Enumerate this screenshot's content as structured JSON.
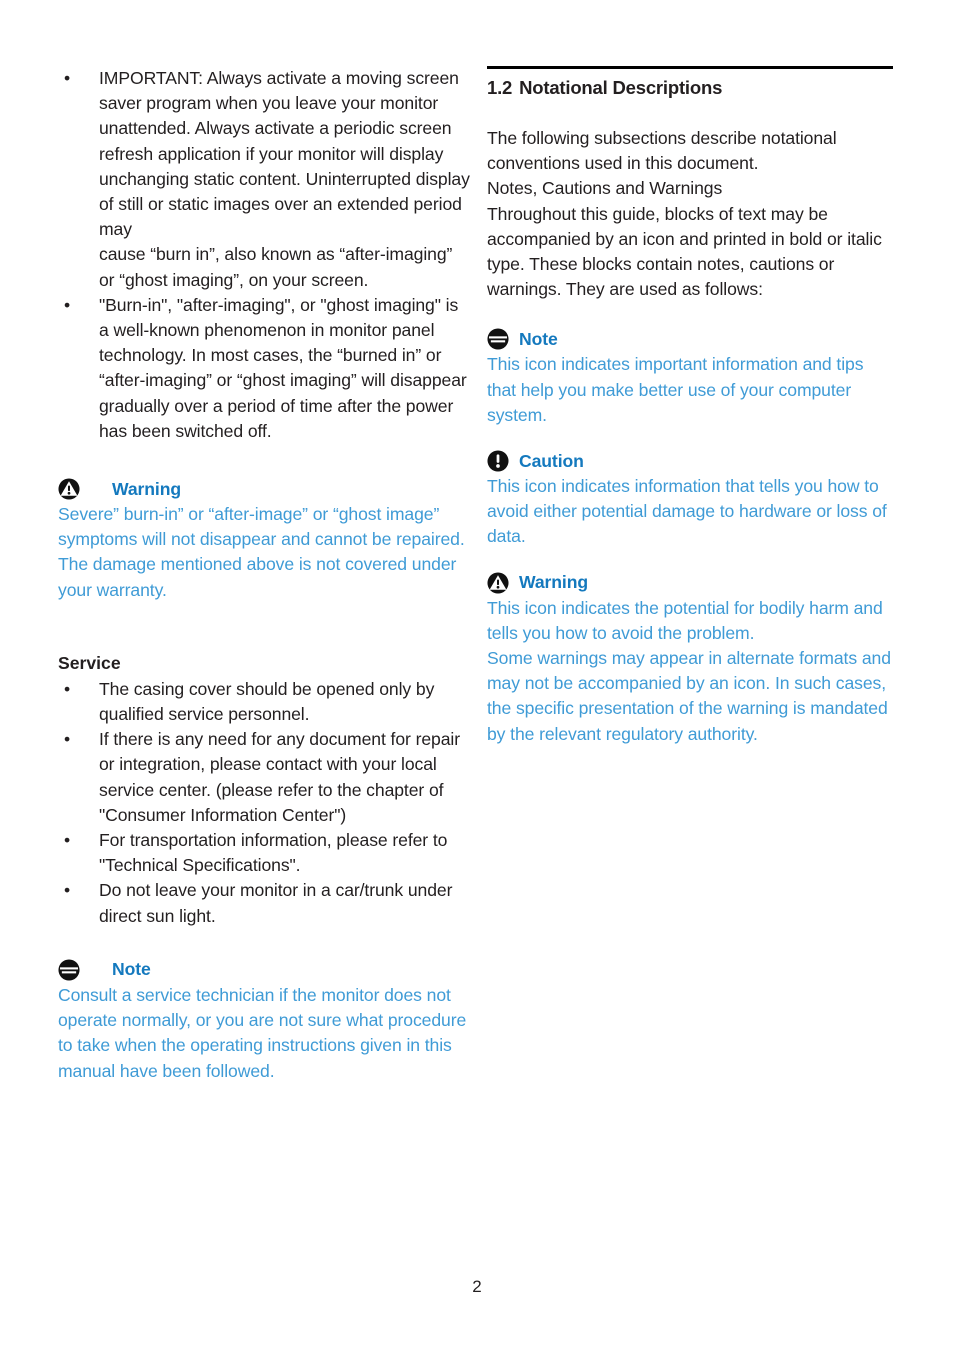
{
  "colors": {
    "heading_blue": "#1479be",
    "body_blue": "#3f9bd6",
    "text_black": "#231f20",
    "rule_black": "#000000"
  },
  "left_column": {
    "bullets": [
      "IMPORTANT: Always activate a moving screen saver program when you leave your monitor unattended. Always activate a periodic screen refresh application if your monitor will display unchanging static content. Uninterrupted display of still or static images over an extended period may\ncause “burn in”, also known as “after-imaging” or “ghost imaging”,  on your screen.",
      "\"Burn-in\", \"after-imaging\", or \"ghost imaging\" is a well-known phenomenon in monitor panel technology. In most cases, the “burned in” or “after-imaging” or “ghost imaging” will disappear gradually over a period of time after the power has been switched off."
    ],
    "warning_callout": {
      "icon": "warning-triangle-icon",
      "label": "Warning",
      "body": "Severe” burn-in” or “after-image” or “ghost image” symptoms will not disappear and cannot be repaired. The damage mentioned above is not covered under your warranty."
    },
    "service": {
      "heading": "Service",
      "bullets": [
        "The casing cover should be opened only by qualified service personnel.",
        "If there is any need for any document for repair or integration, please contact with your local service center. (please refer to the chapter of \"Consumer Information Center\")",
        "For transportation information, please refer to \"Technical Specifications\".",
        "Do not leave your monitor in a car/trunk under direct sun light."
      ]
    },
    "note_callout": {
      "icon": "note-lines-icon",
      "label": "Note",
      "body": "Consult a service technician if the monitor does not operate normally, or you are not sure what procedure to take when the operating instructions given in this manual have been followed."
    }
  },
  "right_column": {
    "section": {
      "number": "1.2",
      "title": "Notational Descriptions"
    },
    "intro": "The following subsections describe notational conventions used in this document.\nNotes, Cautions and Warnings\nThroughout this guide, blocks of text may be accompanied by an icon and printed in bold or italic type. These blocks contain notes, cautions or warnings. They are used as follows:",
    "callouts": [
      {
        "icon": "note-lines-icon",
        "label": "Note",
        "body": "This icon indicates important information and tips that help you make better use of your computer system."
      },
      {
        "icon": "caution-exclamation-icon",
        "label": "Caution",
        "body": "This icon indicates information that tells you how to avoid either potential damage to hardware or loss of data."
      },
      {
        "icon": "warning-triangle-icon",
        "label": "Warning",
        "body": "This icon indicates the potential for bodily harm and tells you how to avoid the problem.\nSome warnings may appear in alternate formats and may not be accompanied by an icon. In such cases, the specific presentation of the warning is mandated by the relevant regulatory authority."
      }
    ]
  },
  "footer": {
    "page_number": "2"
  }
}
